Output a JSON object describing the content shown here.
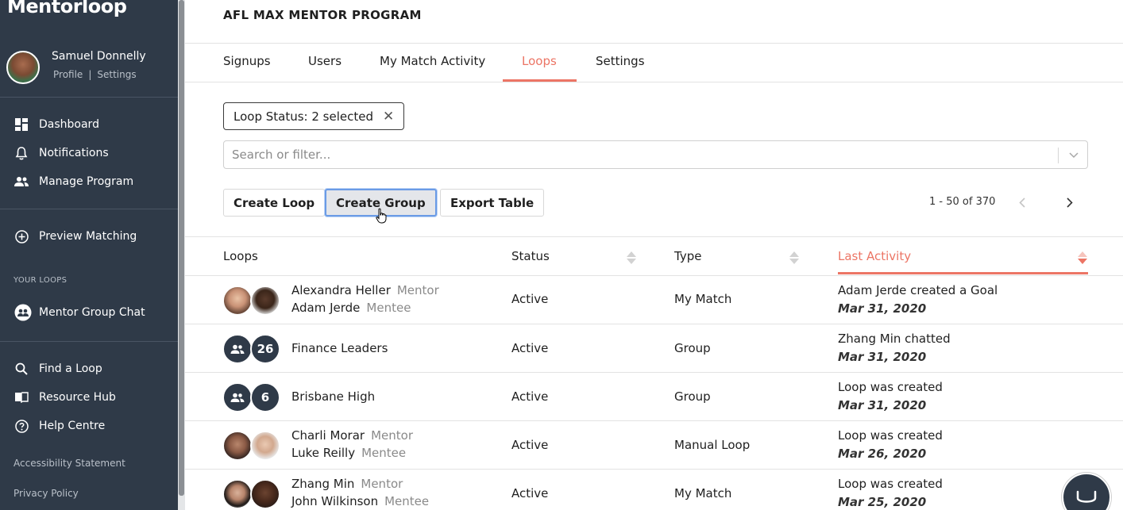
{
  "sidebar": {
    "logo": "Mentorloop",
    "profile": {
      "name": "Samuel Donnelly",
      "profile_link": "Profile",
      "sep": "|",
      "settings_link": "Settings"
    },
    "nav": [
      {
        "label": "Dashboard",
        "icon": "dashboard-icon"
      },
      {
        "label": "Notifications",
        "icon": "bell-icon"
      },
      {
        "label": "Manage Program",
        "icon": "people-icon"
      },
      {
        "label": "Preview Matching",
        "icon": "plus-circle-icon"
      }
    ],
    "loops_section": "YOUR LOOPS",
    "loops": [
      {
        "label": "Mentor Group Chat",
        "icon": "group-chat-icon"
      }
    ],
    "tools": [
      {
        "label": "Find a Loop",
        "icon": "search-icon"
      },
      {
        "label": "Resource Hub",
        "icon": "book-icon"
      },
      {
        "label": "Help Centre",
        "icon": "help-icon"
      }
    ],
    "footer_links": [
      "Accessibility Statement",
      "Privacy Policy"
    ]
  },
  "header": {
    "program_title": "AFL MAX MENTOR PROGRAM"
  },
  "tabs": [
    {
      "label": "Signups",
      "active": false
    },
    {
      "label": "Users",
      "active": false
    },
    {
      "label": "My Match Activity",
      "active": false
    },
    {
      "label": "Loops",
      "active": true
    },
    {
      "label": "Settings",
      "active": false
    }
  ],
  "filter": {
    "chip_label": "Loop Status: 2 selected",
    "chip_close": "✕",
    "search_placeholder": "Search or filter..."
  },
  "actions": {
    "create_loop": "Create Loop",
    "create_group": "Create Group",
    "export_table": "Export Table"
  },
  "pagination": {
    "range": "1 - 50 of 370"
  },
  "table": {
    "headers": {
      "loops": "Loops",
      "status": "Status",
      "type": "Type",
      "last_activity": "Last Activity"
    },
    "rows": [
      {
        "kind": "pair",
        "name1": "Alexandra Heller",
        "role1": "Mentor",
        "name2": "Adam Jerde",
        "role2": "Mentee",
        "status": "Active",
        "type": "My Match",
        "activity": "Adam Jerde created a Goal",
        "date": "Mar 31, 2020"
      },
      {
        "kind": "group",
        "count": "26",
        "name": "Finance Leaders",
        "status": "Active",
        "type": "Group",
        "activity": "Zhang Min chatted",
        "date": "Mar 31, 2020"
      },
      {
        "kind": "group",
        "count": "6",
        "name": "Brisbane High",
        "status": "Active",
        "type": "Group",
        "activity": "Loop was created",
        "date": "Mar 31, 2020"
      },
      {
        "kind": "pair",
        "name1": "Charli Morar",
        "role1": "Mentor",
        "name2": "Luke Reilly",
        "role2": "Mentee",
        "status": "Active",
        "type": "Manual Loop",
        "activity": "Loop was created",
        "date": "Mar 26, 2020"
      },
      {
        "kind": "pair",
        "name1": "Zhang Min",
        "role1": "Mentor",
        "name2": "John Wilkinson",
        "role2": "Mentee",
        "status": "Active",
        "type": "My Match",
        "activity": "Loop was created",
        "date": "Mar 25, 2020"
      }
    ]
  },
  "colors": {
    "sidebar_bg": "#2f3a48",
    "accent": "#ec7565",
    "focus_ring": "#6a9be6"
  }
}
